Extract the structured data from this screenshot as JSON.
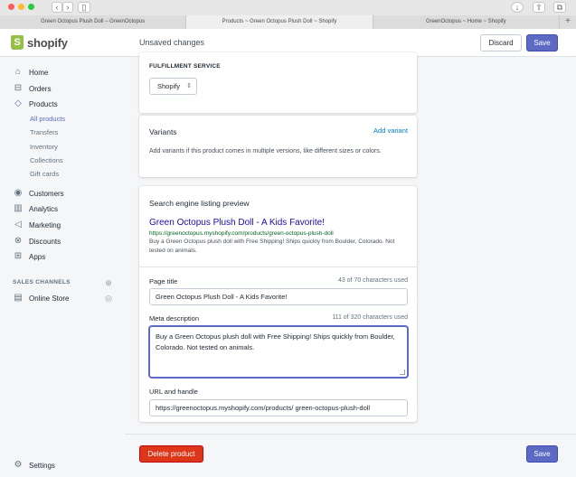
{
  "browser": {
    "tabs": [
      "Green Octopus Plush Doll – GreenOctopus",
      "Products ~ Green Octopus Plush Doll ~ Shopify",
      "GreenOctopus ~ Home ~ Shopify"
    ],
    "new_tab": "+"
  },
  "topbar": {
    "logo_text": "shopify",
    "status": "Unsaved changes",
    "discard_label": "Discard",
    "save_label": "Save"
  },
  "sidebar": {
    "items": [
      {
        "label": "Home",
        "icon": "home-icon"
      },
      {
        "label": "Orders",
        "icon": "orders-icon"
      },
      {
        "label": "Products",
        "icon": "tag-icon"
      },
      {
        "label": "Customers",
        "icon": "person-icon"
      },
      {
        "label": "Analytics",
        "icon": "bar-chart-icon"
      },
      {
        "label": "Marketing",
        "icon": "megaphone-icon"
      },
      {
        "label": "Discounts",
        "icon": "discount-icon"
      },
      {
        "label": "Apps",
        "icon": "apps-icon"
      }
    ],
    "sub_items": [
      "All products",
      "Transfers",
      "Inventory",
      "Collections",
      "Gift cards"
    ],
    "channels_heading": "SALES CHANNELS",
    "online_store_label": "Online Store",
    "settings_label": "Settings"
  },
  "fulfillment": {
    "heading": "FULFILLMENT SERVICE",
    "selected": "Shopify"
  },
  "variants": {
    "title": "Variants",
    "add_label": "Add variant",
    "description": "Add variants if this product comes in multiple versions, like different sizes or colors."
  },
  "seo": {
    "title": "Search engine listing preview",
    "preview_title": "Green Octopus Plush Doll - A Kids Favorite!",
    "preview_url": "https://greenoctopus.myshopify.com/products/green-octopus-plush-doll",
    "preview_description": "Buy a Green Octopus plush doll with Free Shipping! Ships quickly from Boulder, Colorado. Not tested on animals.",
    "page_title_label": "Page title",
    "page_title_count": "43 of 70 characters used",
    "page_title_value": "Green Octopus Plush Doll - A Kids Favorite!",
    "meta_label": "Meta description",
    "meta_count": "111 of 320 characters used",
    "meta_value": "Buy a Green Octopus plush doll with Free Shipping! Ships quickly from Boulder, Colorado. Not tested on animals.",
    "url_label": "URL and handle",
    "url_value": "https://greenoctopus.myshopify.com/products/ green-octopus-plush-doll"
  },
  "footer": {
    "delete_label": "Delete product",
    "save_label": "Save"
  },
  "colors": {
    "primary": "#5c6ac4",
    "danger": "#de3618",
    "link": "#007ace",
    "seo_title": "#1a0dab",
    "seo_url": "#006621"
  }
}
